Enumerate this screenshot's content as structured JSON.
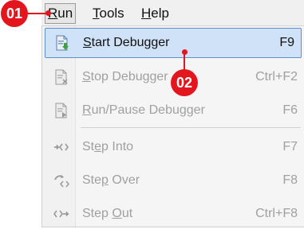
{
  "menubar": {
    "items": [
      {
        "label": "Run",
        "mnemonic": "R",
        "rest": "un",
        "active": true
      },
      {
        "label": "Tools",
        "mnemonic": "T",
        "rest": "ools"
      },
      {
        "label": "Help",
        "mnemonic": "H",
        "rest": "elp"
      }
    ]
  },
  "run_menu": {
    "start": {
      "pre": "",
      "u": "S",
      "post": "tart Debugger",
      "shortcut": "F9"
    },
    "stop": {
      "pre": "",
      "u": "S",
      "post": "top Debugger",
      "shortcut": "Ctrl+F2"
    },
    "pause": {
      "pre": "",
      "u": "R",
      "post": "un/Pause Debugger",
      "shortcut": "F6"
    },
    "step_into": {
      "pre": "St",
      "u": "e",
      "post": "p Into",
      "shortcut": "F7"
    },
    "step_over": {
      "pre": "Ste",
      "u": "p",
      "post": " Over",
      "shortcut": "F8"
    },
    "step_out": {
      "pre": "Step ",
      "u": "O",
      "post": "ut",
      "shortcut": "Ctrl+F8"
    }
  },
  "callouts": {
    "one": "01",
    "two": "02"
  },
  "colors": {
    "callout": "#e3161d",
    "highlight": "#cfe2f7",
    "highlight_border": "#5b8fd0"
  }
}
